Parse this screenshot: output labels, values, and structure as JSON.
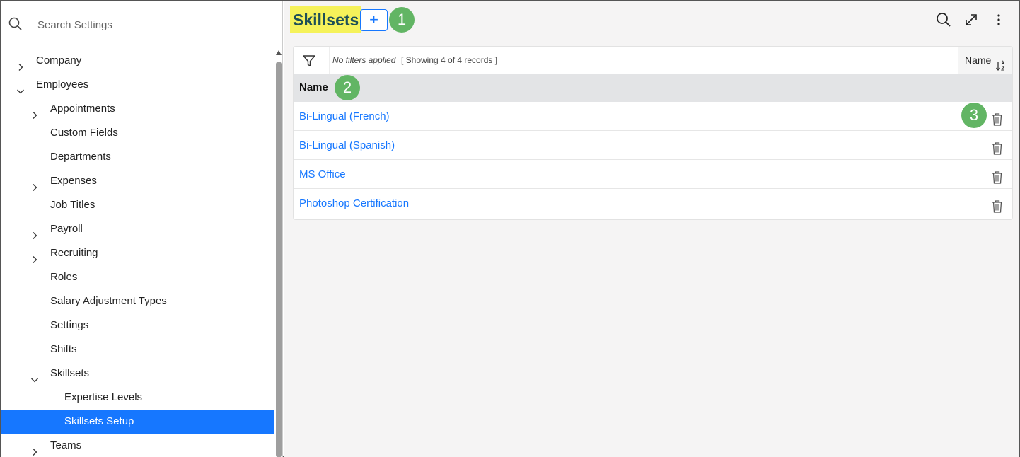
{
  "sidebar": {
    "search_placeholder": "Search Settings",
    "items": [
      {
        "label": "Company",
        "level": 0,
        "chevron": "right"
      },
      {
        "label": "Employees",
        "level": 0,
        "chevron": "down"
      },
      {
        "label": "Appointments",
        "level": 1,
        "chevron": "right"
      },
      {
        "label": "Custom Fields",
        "level": 1,
        "chevron": "none"
      },
      {
        "label": "Departments",
        "level": 1,
        "chevron": "none"
      },
      {
        "label": "Expenses",
        "level": 1,
        "chevron": "right"
      },
      {
        "label": "Job Titles",
        "level": 1,
        "chevron": "none"
      },
      {
        "label": "Payroll",
        "level": 1,
        "chevron": "right"
      },
      {
        "label": "Recruiting",
        "level": 1,
        "chevron": "right"
      },
      {
        "label": "Roles",
        "level": 1,
        "chevron": "none"
      },
      {
        "label": "Salary Adjustment Types",
        "level": 1,
        "chevron": "none"
      },
      {
        "label": "Settings",
        "level": 1,
        "chevron": "none"
      },
      {
        "label": "Shifts",
        "level": 1,
        "chevron": "none"
      },
      {
        "label": "Skillsets",
        "level": 1,
        "chevron": "down"
      },
      {
        "label": "Expertise Levels",
        "level": 2,
        "chevron": "none"
      },
      {
        "label": "Skillsets Setup",
        "level": 2,
        "chevron": "none",
        "selected": true
      },
      {
        "label": "Teams",
        "level": 1,
        "chevron": "right"
      }
    ]
  },
  "header": {
    "title": "Skillsets",
    "add_label": "+",
    "callouts": [
      "1",
      "2",
      "3"
    ]
  },
  "toolbar": {
    "filter_status": "No filters applied",
    "records_text": "[ Showing 4 of 4 records ]",
    "sort_label": "Name"
  },
  "table": {
    "column_header": "Name",
    "rows": [
      "Bi-Lingual (French)",
      "Bi-Lingual (Spanish)",
      "MS Office",
      "Photoshop Certification"
    ]
  },
  "colors": {
    "accent": "#1677ff",
    "highlight": "#f5f25a",
    "callout": "#62b564",
    "title_text": "#1d4f57"
  }
}
